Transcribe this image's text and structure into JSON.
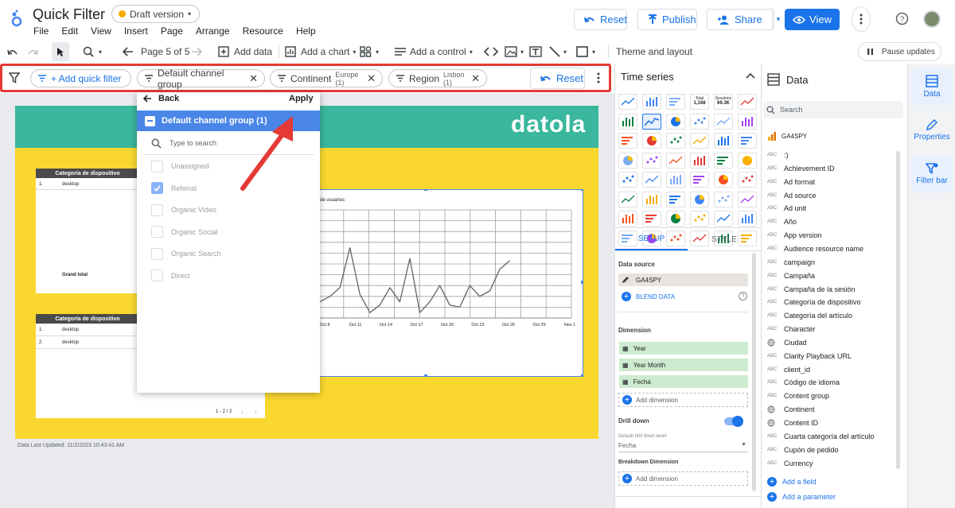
{
  "header": {
    "title": "Quick Filter",
    "draft_label": "Draft version",
    "menu": [
      "File",
      "Edit",
      "View",
      "Insert",
      "Page",
      "Arrange",
      "Resource",
      "Help"
    ],
    "reset_label": "Reset",
    "publish_label": "Publish",
    "share_label": "Share",
    "view_label": "View"
  },
  "toolbar": {
    "page_label": "Page 5 of 5",
    "add_data": "Add data",
    "add_chart": "Add a chart",
    "add_control": "Add a control",
    "theme_layout": "Theme and layout",
    "pause_updates": "Pause updates"
  },
  "filter_bar": {
    "add_quick_filter": "+ Add quick filter",
    "chips": [
      {
        "label": "Default channel group",
        "value": ""
      },
      {
        "label": "Continent",
        "value": "Europe (1)"
      },
      {
        "label": "Region",
        "value": "Lisbon (1)"
      }
    ],
    "reset_label": "Reset"
  },
  "dropdown": {
    "back_label": "Back",
    "apply_label": "Apply",
    "selected_header": "Default channel group (1)",
    "search_placeholder": "Type to search",
    "options": [
      {
        "label": "Unassigned",
        "checked": false
      },
      {
        "label": "Referral",
        "checked": true
      },
      {
        "label": "Organic Video",
        "checked": false
      },
      {
        "label": "Organic Social",
        "checked": false
      },
      {
        "label": "Organic Search",
        "checked": false
      },
      {
        "label": "Direct",
        "checked": false
      }
    ]
  },
  "report": {
    "brand": "datola",
    "table1": {
      "header": "Categoría de dispositivo",
      "row_num": "1.",
      "row_val": "desktop",
      "total_label": "Grand total"
    },
    "table2": {
      "header": "Categoría de dispositivo",
      "rows": [
        [
          "1.",
          "desktop"
        ],
        [
          "2.",
          "desktop"
        ]
      ],
      "pager": "1 - 2 / 2"
    },
    "chart_title": "de usuarios",
    "last_updated": "Data Last Updated: 11/2/2023 10:43:41 AM"
  },
  "chart_data": {
    "type": "line",
    "title": "de usuarios",
    "x": [
      "Oct 8",
      "Oct 11",
      "Oct 14",
      "Oct 17",
      "Oct 20",
      "Oct 23",
      "Oct 26",
      "Oct 29",
      "Nov 1"
    ],
    "series": [
      {
        "values": [
          0.15,
          0.2,
          0.28,
          0.65,
          0.22,
          0.05,
          0.12,
          0.28,
          0.15,
          0.55,
          0.05,
          0.15,
          0.3,
          0.12,
          0.1,
          0.3,
          0.2,
          0.25,
          0.45,
          0.53
        ]
      }
    ]
  },
  "chart_panel": {
    "title": "Time series",
    "tab_setup": "SETUP",
    "tab_style": "STYLE",
    "data_source_label": "Data source",
    "data_source": "GA4SPY",
    "blend_data": "BLEND DATA",
    "dimension_label": "Dimension",
    "dimensions": [
      "Year",
      "Year Month",
      "Fecha"
    ],
    "add_dimension": "Add dimension",
    "drill_down": "Drill down",
    "default_drill_label": "Default drill down level",
    "default_drill_value": "Fecha",
    "breakdown_label": "Breakdown Dimension",
    "add_dimension2": "Add dimension",
    "total_icon_text": "Total\n1,168",
    "session_icon_text": "Sessions\n69.3K"
  },
  "data_panel": {
    "title": "Data",
    "search_placeholder": "Search",
    "source_name": "GA4SPY",
    "fields": [
      ":)",
      "Achievement ID",
      "Ad format",
      "Ad source",
      "Ad unit",
      "Año",
      "App version",
      "Audience resource name",
      "campaign",
      "Campaña",
      "Campaña de la sesión",
      "Categoría de dispositivo",
      "Categoría del artículo",
      "Character",
      "Ciudad",
      "Clarity Playback URL",
      "client_id",
      "Código de idioma",
      "Content group",
      "Continent",
      "Content ID",
      "Cuarta categoría del artículo",
      "Cupón de pedido",
      "Currency"
    ],
    "add_field": "Add a field",
    "add_parameter": "Add a parameter"
  },
  "side_tabs": [
    "Data",
    "Properties",
    "Filter bar"
  ],
  "accent_color": "#1a73e8",
  "annotation_color": "#e53935"
}
